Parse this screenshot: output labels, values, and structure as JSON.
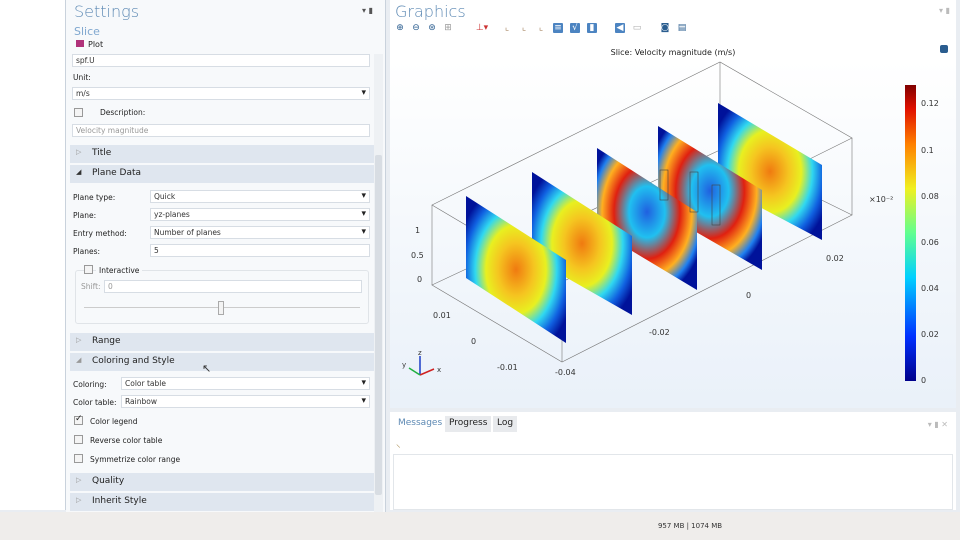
{
  "settings": {
    "title": "Settings",
    "subtitle": "Slice",
    "plot_label": "Plot",
    "expression": "spf.U",
    "unit_label": "Unit:",
    "unit_value": "m/s",
    "description_label": "Description:",
    "description_value": "Velocity magnitude",
    "sections": {
      "title": "Title",
      "plane_data": "Plane Data",
      "range": "Range",
      "coloring": "Coloring and Style",
      "quality": "Quality",
      "inherit": "Inherit Style"
    },
    "plane_type_label": "Plane type:",
    "plane_type": "Quick",
    "plane_label": "Plane:",
    "plane": "yz-planes",
    "entry_label": "Entry method:",
    "entry": "Number of planes",
    "planes_label": "Planes:",
    "planes": "5",
    "interactive_label": "Interactive",
    "shift_label": "Shift:",
    "shift": "0",
    "coloring_label": "Coloring:",
    "coloring": "Color table",
    "color_table_label": "Color table:",
    "color_table": "Rainbow",
    "color_legend": "Color legend",
    "reverse": "Reverse color table",
    "symmetrize": "Symmetrize color range"
  },
  "graphics": {
    "title": "Graphics",
    "plot_title": "Slice: Velocity magnitude (m/s)",
    "colorbar_ticks": [
      "0.12",
      "0.1",
      "0.08",
      "0.06",
      "0.04",
      "0.02",
      "0"
    ],
    "axis_labels": {
      "z1": "1",
      "z05": "0.5",
      "z0": "0",
      "y001": "0.01",
      "y0": "0",
      "ym001": "-0.01",
      "xm004": "-0.04",
      "xm002": "-0.02",
      "x0": "0",
      "x002": "0.02",
      "exp": "×10⁻²"
    },
    "triad": {
      "x": "x",
      "y": "y",
      "z": "z"
    }
  },
  "messages": {
    "tabs": [
      "Messages",
      "Progress",
      "Log"
    ]
  },
  "status": {
    "memory": "957 MB | 1074 MB"
  }
}
